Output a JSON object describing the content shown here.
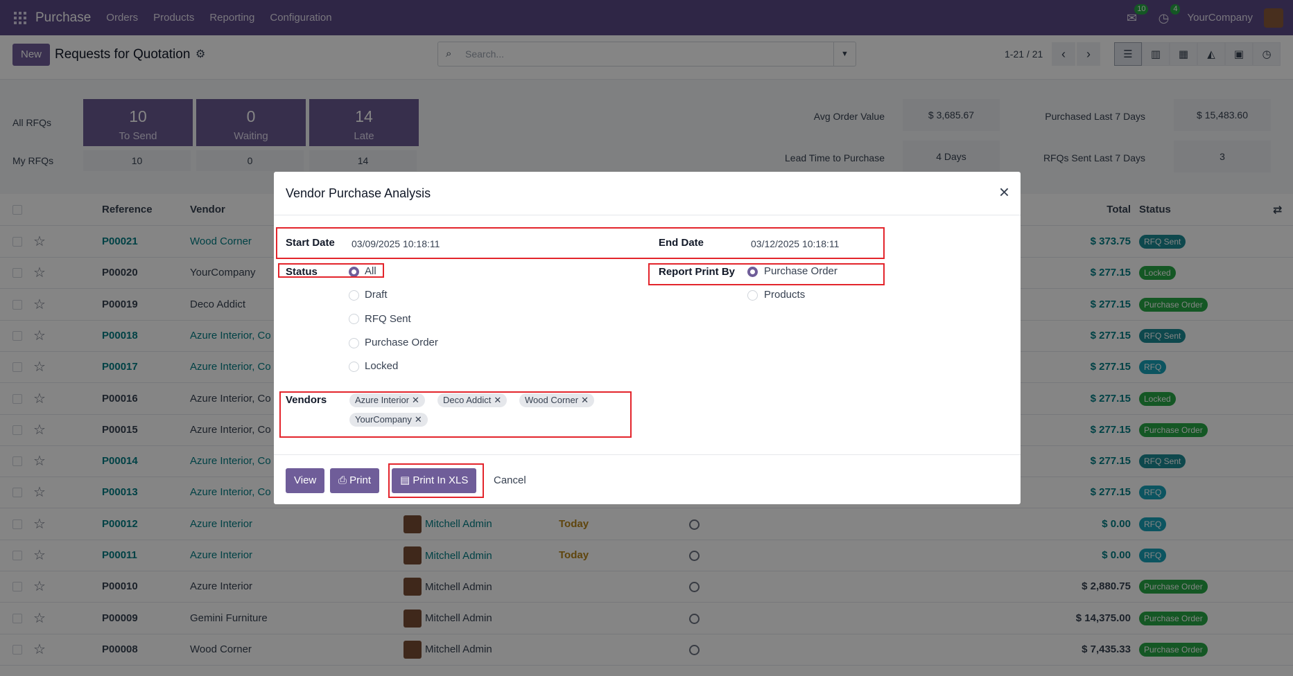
{
  "topbar": {
    "app_name": "Purchase",
    "menu": [
      "Orders",
      "Products",
      "Reporting",
      "Configuration"
    ],
    "messages_count": "10",
    "activities_count": "4",
    "company": "YourCompany"
  },
  "control_panel": {
    "new_label": "New",
    "title": "Requests for Quotation",
    "search_placeholder": "Search...",
    "pager": "1-21 / 21"
  },
  "dashboard": {
    "all_rfqs_label": "All RFQs",
    "my_rfqs_label": "My RFQs",
    "tiles": [
      {
        "value": "10",
        "label": "To Send",
        "my": "10"
      },
      {
        "value": "0",
        "label": "Waiting",
        "my": "0"
      },
      {
        "value": "14",
        "label": "Late",
        "my": "14"
      }
    ],
    "stats": {
      "avg_order_value_label": "Avg Order Value",
      "avg_order_value": "$ 3,685.67",
      "purchased_last_7_label": "Purchased Last 7 Days",
      "purchased_last_7": "$ 15,483.60",
      "lead_time_label": "Lead Time to Purchase",
      "lead_time": "4 Days",
      "rfqs_sent_label": "RFQs Sent Last 7 Days",
      "rfqs_sent": "3"
    }
  },
  "list": {
    "headers": {
      "reference": "Reference",
      "vendor": "Vendor",
      "total": "Total",
      "status": "Status"
    },
    "rows": [
      {
        "ref": "P00021",
        "vendor": "Wood Corner",
        "buyer": "",
        "deadline": "",
        "total": "$ 373.75",
        "status": "RFQ Sent"
      },
      {
        "ref": "P00020",
        "vendor": "YourCompany",
        "buyer": "",
        "deadline": "",
        "total": "$ 277.15",
        "status": "Locked"
      },
      {
        "ref": "P00019",
        "vendor": "Deco Addict",
        "buyer": "",
        "deadline": "",
        "total": "$ 277.15",
        "status": "Purchase Order"
      },
      {
        "ref": "P00018",
        "vendor": "Azure Interior, Co",
        "buyer": "",
        "deadline": "",
        "total": "$ 277.15",
        "status": "RFQ Sent"
      },
      {
        "ref": "P00017",
        "vendor": "Azure Interior, Co",
        "buyer": "",
        "deadline": "",
        "total": "$ 277.15",
        "status": "RFQ"
      },
      {
        "ref": "P00016",
        "vendor": "Azure Interior, Co",
        "buyer": "",
        "deadline": "",
        "total": "$ 277.15",
        "status": "Locked"
      },
      {
        "ref": "P00015",
        "vendor": "Azure Interior, Co",
        "buyer": "",
        "deadline": "",
        "total": "$ 277.15",
        "status": "Purchase Order"
      },
      {
        "ref": "P00014",
        "vendor": "Azure Interior, Co",
        "buyer": "",
        "deadline": "",
        "total": "$ 277.15",
        "status": "RFQ Sent"
      },
      {
        "ref": "P00013",
        "vendor": "Azure Interior, Co",
        "buyer": "",
        "deadline": "",
        "total": "$ 277.15",
        "status": "RFQ"
      },
      {
        "ref": "P00012",
        "vendor": "Azure Interior",
        "buyer": "Mitchell Admin",
        "deadline": "Today",
        "total": "$ 0.00",
        "status": "RFQ"
      },
      {
        "ref": "P00011",
        "vendor": "Azure Interior",
        "buyer": "Mitchell Admin",
        "deadline": "Today",
        "total": "$ 0.00",
        "status": "RFQ"
      },
      {
        "ref": "P00010",
        "vendor": "Azure Interior",
        "buyer": "Mitchell Admin",
        "deadline": "",
        "total": "$ 2,880.75",
        "status": "Purchase Order"
      },
      {
        "ref": "P00009",
        "vendor": "Gemini Furniture",
        "buyer": "Mitchell Admin",
        "deadline": "",
        "total": "$ 14,375.00",
        "status": "Purchase Order"
      },
      {
        "ref": "P00008",
        "vendor": "Wood Corner",
        "buyer": "Mitchell Admin",
        "deadline": "",
        "total": "$ 7,435.33",
        "status": "Purchase Order"
      }
    ]
  },
  "colors": {
    "brand": "#5b4a86",
    "primary_button": "#6f5d99",
    "link": "#017e84",
    "badge_rfq_sent": "#1b8a94",
    "badge_locked": "#28a745",
    "badge_purchase_order": "#28a745",
    "badge_rfq": "#17a2b8",
    "highlight_box": "#e3242b"
  },
  "modal": {
    "title": "Vendor Purchase Analysis",
    "start_date_label": "Start Date",
    "start_date": "03/09/2025 10:18:11",
    "end_date_label": "End Date",
    "end_date": "03/12/2025 10:18:11",
    "status_label": "Status",
    "status_options": [
      "All",
      "Draft",
      "RFQ Sent",
      "Purchase Order",
      "Locked"
    ],
    "status_selected": "All",
    "report_print_by_label": "Report Print By",
    "report_options": [
      "Purchase Order",
      "Products"
    ],
    "report_selected": "Purchase Order",
    "vendors_label": "Vendors",
    "vendors": [
      "Azure Interior",
      "Deco Addict",
      "Wood Corner",
      "YourCompany"
    ],
    "buttons": {
      "view": "View",
      "print": "Print",
      "print_xls": "Print In XLS",
      "cancel": "Cancel"
    }
  }
}
